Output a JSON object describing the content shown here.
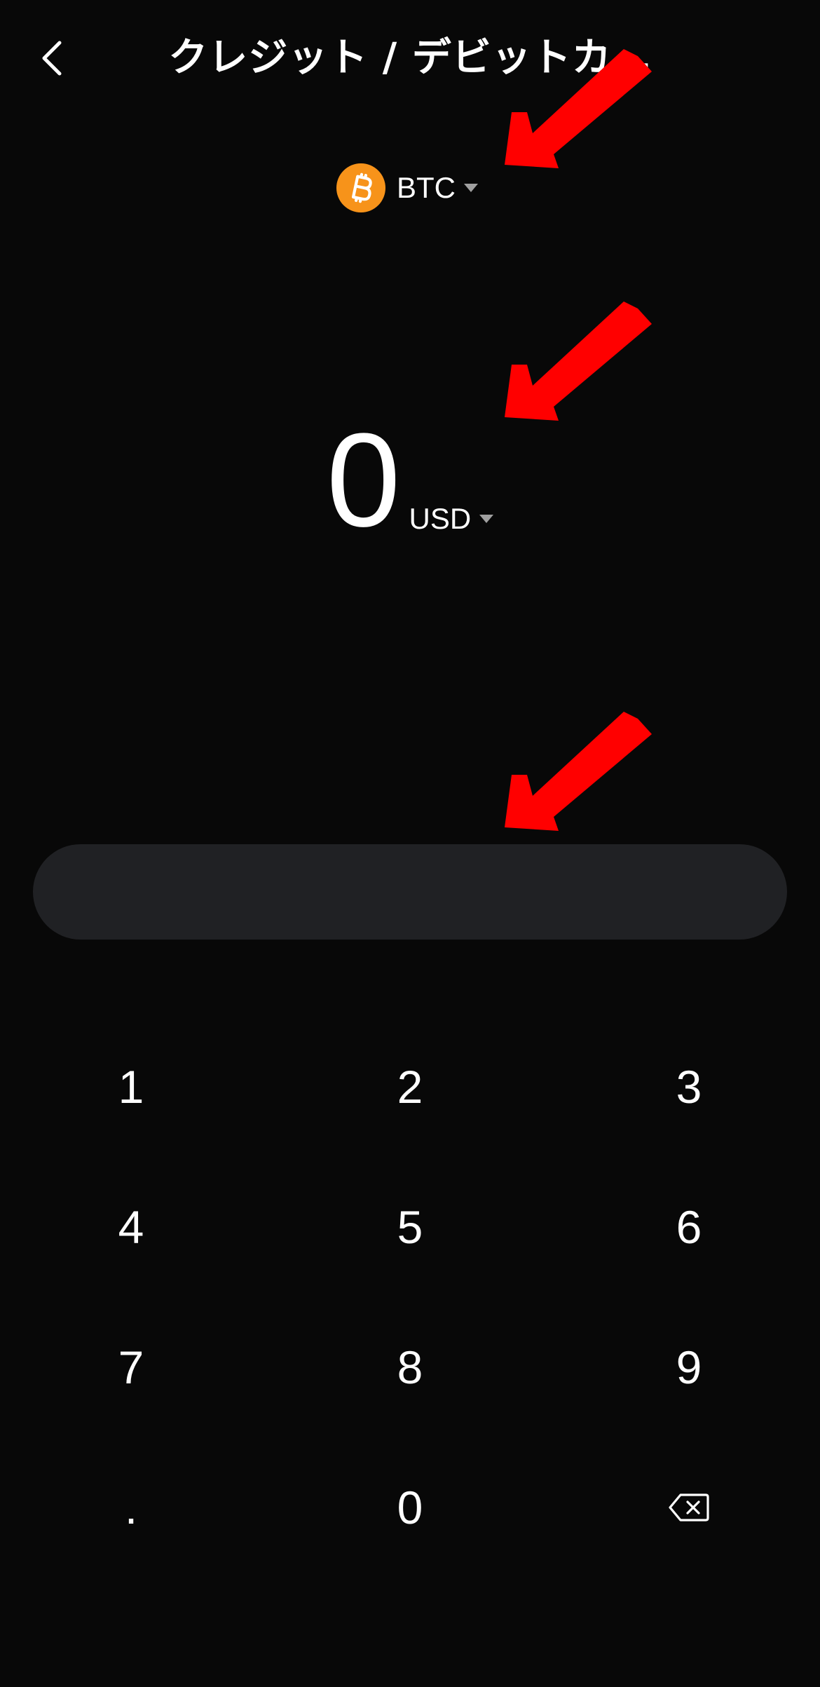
{
  "header": {
    "back_icon": "chevron-left-icon",
    "title": "クレジット / デビットカ…"
  },
  "asset": {
    "icon": "bitcoin-icon",
    "color": "#F7931A",
    "label": "BTC",
    "caret_icon": "caret-down-icon"
  },
  "amount": {
    "value": "0",
    "currency": "USD",
    "caret_icon": "caret-down-icon"
  },
  "action_button": {
    "label": "",
    "color": "#202124"
  },
  "annotations": {
    "arrow_color": "#FF0000",
    "arrow_icon": "red-arrow-icon"
  },
  "keypad": {
    "keys": [
      "1",
      "2",
      "3",
      "4",
      "5",
      "6",
      "7",
      "8",
      "9",
      ".",
      "0"
    ],
    "backspace_icon": "backspace-icon"
  },
  "colors": {
    "background": "#080808",
    "text": "#FFFFFF",
    "muted": "#A0A0A0"
  }
}
